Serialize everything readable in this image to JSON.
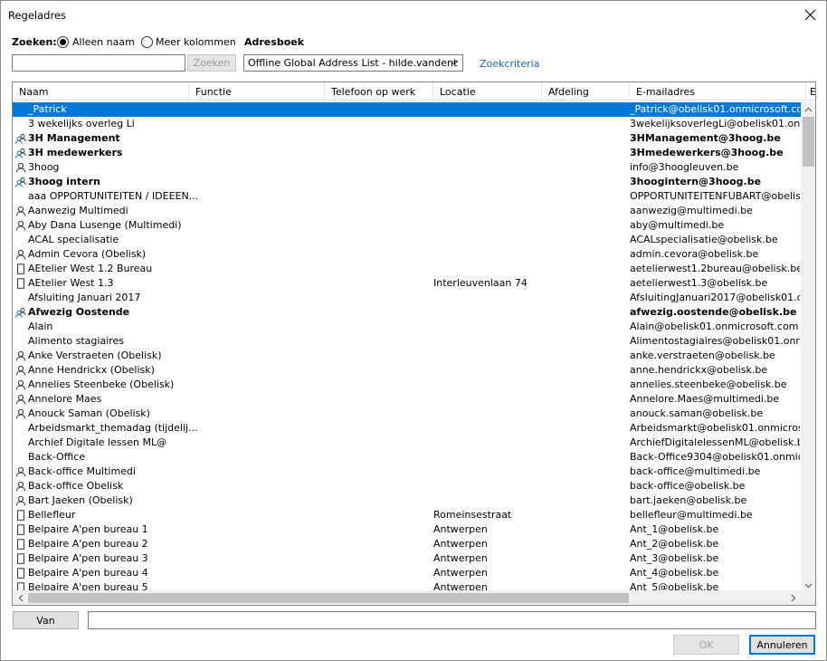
{
  "window": {
    "title": "Regeladres"
  },
  "search": {
    "label": "Zoeken:",
    "opt_name": "Alleen naam",
    "opt_more": "Meer kolommen",
    "value": "",
    "button": "Zoeken",
    "adresboek_label": "Adresboek",
    "adresboek_value": "Offline Global Address List - hilde.vandent",
    "advanced": "Zoekcriteria"
  },
  "columns": [
    "Naam",
    "Functie",
    "Telefoon op werk",
    "Locatie",
    "Afdeling",
    "E-mailadres",
    "E"
  ],
  "rows": [
    {
      "name": "_Patrick",
      "location": "",
      "email": "_Patrick@obelisk01.onmicrosoft.com",
      "icon": "none",
      "bold": false,
      "selected": true
    },
    {
      "name": "3 wekelijks overleg Li",
      "location": "",
      "email": "3wekelijksoverlegLi@obelisk01.on...",
      "icon": "none",
      "bold": false
    },
    {
      "name": "3H Management",
      "location": "",
      "email": "3HManagement@3hoog.be",
      "icon": "group-icon",
      "bold": true
    },
    {
      "name": "3H medewerkers",
      "location": "",
      "email": "3Hmedewerkers@3hoog.be",
      "icon": "group-icon",
      "bold": true
    },
    {
      "name": "3hoog",
      "location": "",
      "email": "info@3hoogleuven.be",
      "icon": "person-icon",
      "bold": false
    },
    {
      "name": "3hoog intern",
      "location": "",
      "email": "3hoogintern@3hoog.be",
      "icon": "group-icon",
      "bold": true
    },
    {
      "name": "aaa OPPORTUNITEITEN / IDEEEN...",
      "location": "",
      "email": "OPPORTUNITEITENFUBART@obelis...",
      "icon": "none",
      "bold": false
    },
    {
      "name": "Aanwezig Multimedi",
      "location": "",
      "email": "aanwezig@multimedi.be",
      "icon": "person-icon",
      "bold": false
    },
    {
      "name": "Aby Dana Lusenge (Multimedi)",
      "location": "",
      "email": "aby@multimedi.be",
      "icon": "person-icon",
      "bold": false
    },
    {
      "name": "ACAL specialisatie",
      "location": "",
      "email": "ACALspecialisatie@obelisk.be",
      "icon": "none",
      "bold": false
    },
    {
      "name": "Admin Cevora (Obelisk)",
      "location": "",
      "email": "admin.cevora@obelisk.be",
      "icon": "person-icon",
      "bold": false
    },
    {
      "name": "AEtelier West 1.2 Bureau",
      "location": "",
      "email": "aetelierwest1.2bureau@obelisk.be",
      "icon": "room-icon",
      "bold": false
    },
    {
      "name": "AEtelier West 1.3",
      "location": "Interleuvenlaan 74",
      "email": "aetelierwest1.3@obelisk.be",
      "icon": "room-icon",
      "bold": false
    },
    {
      "name": "Afsluiting Januari 2017",
      "location": "",
      "email": "AfsluitingJanuari2017@obelisk01.o...",
      "icon": "none",
      "bold": false
    },
    {
      "name": "Afwezig Oostende",
      "location": "",
      "email": "afwezig.oostende@obelisk.be",
      "icon": "group-icon",
      "bold": true
    },
    {
      "name": "Alain",
      "location": "",
      "email": "Alain@obelisk01.onmicrosoft.com",
      "icon": "none",
      "bold": false
    },
    {
      "name": "Alimento stagiaires",
      "location": "",
      "email": "Alimentostagiaires@obelisk01.onm...",
      "icon": "none",
      "bold": false
    },
    {
      "name": "Anke Verstraeten (Obelisk)",
      "location": "",
      "email": "anke.verstraeten@obelisk.be",
      "icon": "person-icon",
      "bold": false
    },
    {
      "name": "Anne Hendrickx (Obelisk)",
      "location": "",
      "email": "anne.hendrickx@obelisk.be",
      "icon": "person-icon",
      "bold": false
    },
    {
      "name": "Annelies Steenbeke (Obelisk)",
      "location": "",
      "email": "annelies.steenbeke@obelisk.be",
      "icon": "person-icon",
      "bold": false
    },
    {
      "name": "Annelore Maes",
      "location": "",
      "email": "Annelore.Maes@multimedi.be",
      "icon": "person-icon",
      "bold": false
    },
    {
      "name": "Anouck Saman (Obelisk)",
      "location": "",
      "email": "anouck.saman@obelisk.be",
      "icon": "person-icon",
      "bold": false
    },
    {
      "name": "Arbeidsmarkt_themadag (tijdelij...",
      "location": "",
      "email": "Arbeidsmarkt@obelisk01.onmicros...",
      "icon": "none",
      "bold": false
    },
    {
      "name": "Archief Digitale lessen ML@",
      "location": "",
      "email": "ArchiefDigitalelessenML@obelisk.be",
      "icon": "none",
      "bold": false
    },
    {
      "name": "Back-Office",
      "location": "",
      "email": "Back-Office9304@obelisk01.onmicr...",
      "icon": "none",
      "bold": false
    },
    {
      "name": "Back-office Multimedi",
      "location": "",
      "email": "back-office@multimedi.be",
      "icon": "person-icon",
      "bold": false
    },
    {
      "name": "Back-office Obelisk",
      "location": "",
      "email": "back-office@obelisk.be",
      "icon": "person-icon",
      "bold": false
    },
    {
      "name": "Bart Jaeken (Obelisk)",
      "location": "",
      "email": "bart.jaeken@obelisk.be",
      "icon": "person-icon",
      "bold": false
    },
    {
      "name": "Bellefleur",
      "location": "Romeinsestraat",
      "email": "bellefleur@multimedi.be",
      "icon": "room-icon",
      "bold": false
    },
    {
      "name": "Belpaire A'pen bureau 1",
      "location": "Antwerpen",
      "email": "Ant_1@obelisk.be",
      "icon": "room-icon",
      "bold": false
    },
    {
      "name": "Belpaire A'pen bureau 2",
      "location": "Antwerpen",
      "email": "Ant_2@obelisk.be",
      "icon": "room-icon",
      "bold": false
    },
    {
      "name": "Belpaire A'pen bureau 3",
      "location": "Antwerpen",
      "email": "Ant_3@obelisk.be",
      "icon": "room-icon",
      "bold": false
    },
    {
      "name": "Belpaire A'pen bureau 4",
      "location": "Antwerpen",
      "email": "Ant_4@obelisk.be",
      "icon": "room-icon",
      "bold": false
    },
    {
      "name": "Belpaire A'pen bureau 5",
      "location": "Antwerpen",
      "email": "Ant_5@obelisk.be",
      "icon": "room-icon",
      "bold": false
    }
  ],
  "footer": {
    "van_button": "Van",
    "van_value": "",
    "ok": "OK",
    "cancel": "Annuleren"
  },
  "colors": {
    "selection": "#0078d7",
    "link": "#1a66b3"
  }
}
